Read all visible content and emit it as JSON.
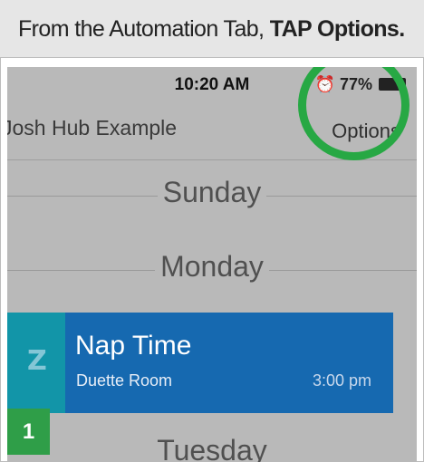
{
  "instruction": {
    "prefix": "From the Automation Tab, ",
    "emphasis": "TAP Options."
  },
  "status_bar": {
    "time": "10:20 AM",
    "alarm_icon": "alarm-clock-icon",
    "battery_text": "77%"
  },
  "navbar": {
    "hub_name": "Josh Hub Example",
    "options_label": "Options"
  },
  "schedule": {
    "days": [
      "Sunday",
      "Monday",
      "Tuesday"
    ],
    "event": {
      "title": "Nap Time",
      "room": "Duette Room",
      "time": "3:00 pm",
      "icon": "sleep-z-icon"
    }
  },
  "step": {
    "number": "1"
  },
  "colors": {
    "highlight": "#27a844",
    "event_bg": "#1669b0",
    "event_icon_bg": "#1295a8",
    "step_badge": "#2f9e48"
  }
}
